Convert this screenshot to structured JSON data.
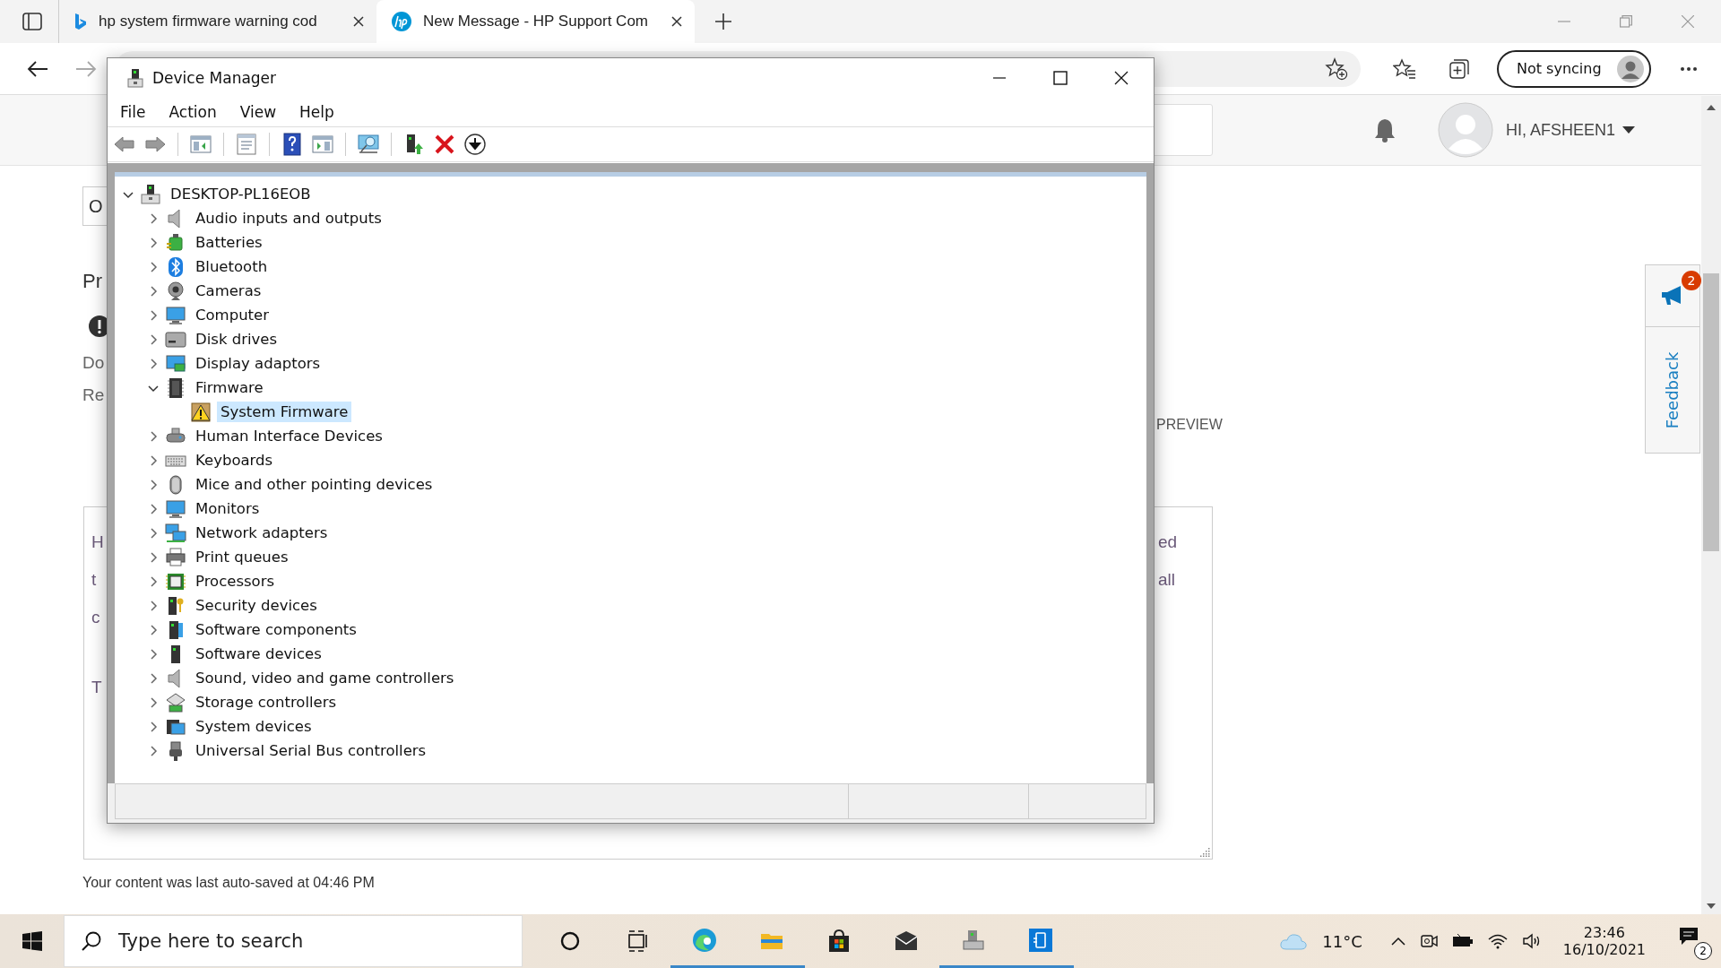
{
  "browser": {
    "tabs": [
      {
        "title": "hp system firmware warning cod",
        "selected": false
      },
      {
        "title": "New Message - HP Support Com",
        "selected": true
      }
    ],
    "sync_button": "Not syncing"
  },
  "page": {
    "user_name": "HI, AFSHEEN1",
    "feedback_count": "2",
    "feedback_label": "Feedback",
    "field_fragment": "O",
    "heading_fragment": "Pr",
    "notice_lines": [
      "Do",
      "Re"
    ],
    "preview_label": "PREVIEW",
    "editor_left": [
      "H",
      "t",
      "c",
      "T"
    ],
    "editor_right": [
      "ed",
      "all"
    ],
    "autosave_text": "Your content was last auto-saved at 04:46 PM"
  },
  "device_manager": {
    "title": "Device Manager",
    "menu": [
      "File",
      "Action",
      "View",
      "Help"
    ],
    "tree": {
      "label": "DESKTOP-PL16EOB",
      "expanded": true,
      "children": [
        {
          "label": "Audio inputs and outputs",
          "expanded": false
        },
        {
          "label": "Batteries",
          "expanded": false
        },
        {
          "label": "Bluetooth",
          "expanded": false
        },
        {
          "label": "Cameras",
          "expanded": false
        },
        {
          "label": "Computer",
          "expanded": false
        },
        {
          "label": "Disk drives",
          "expanded": false
        },
        {
          "label": "Display adaptors",
          "expanded": false
        },
        {
          "label": "Firmware",
          "expanded": true,
          "children": [
            {
              "label": "System Firmware",
              "selected": true,
              "warning": true
            }
          ]
        },
        {
          "label": "Human Interface Devices",
          "expanded": false
        },
        {
          "label": "Keyboards",
          "expanded": false
        },
        {
          "label": "Mice and other pointing devices",
          "expanded": false
        },
        {
          "label": "Monitors",
          "expanded": false
        },
        {
          "label": "Network adapters",
          "expanded": false
        },
        {
          "label": "Print queues",
          "expanded": false
        },
        {
          "label": "Processors",
          "expanded": false
        },
        {
          "label": "Security devices",
          "expanded": false
        },
        {
          "label": "Software components",
          "expanded": false
        },
        {
          "label": "Software devices",
          "expanded": false
        },
        {
          "label": "Sound, video and game controllers",
          "expanded": false
        },
        {
          "label": "Storage controllers",
          "expanded": false
        },
        {
          "label": "System devices",
          "expanded": false
        },
        {
          "label": "Universal Serial Bus controllers",
          "expanded": false
        }
      ]
    }
  },
  "taskbar": {
    "search_placeholder": "Type here to search",
    "temperature": "11°C",
    "time": "23:46",
    "date": "16/10/2021",
    "notification_count": "2"
  }
}
